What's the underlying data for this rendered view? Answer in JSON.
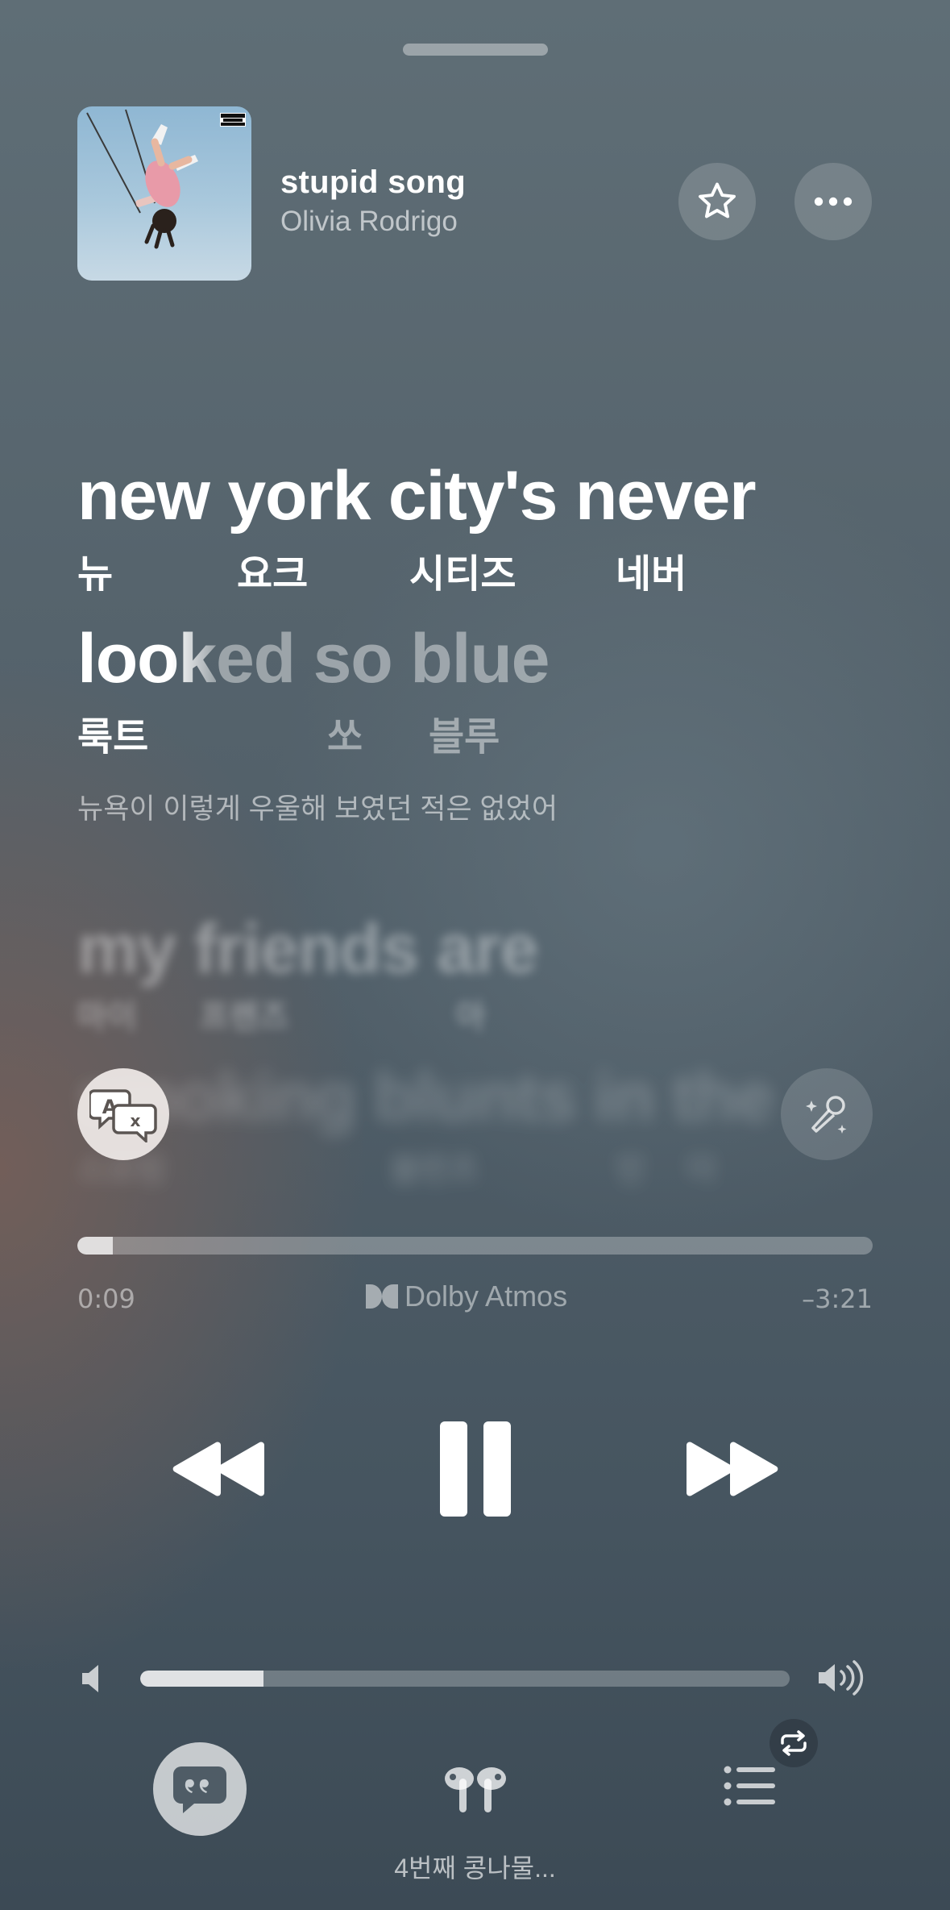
{
  "now_playing": {
    "title": "stupid song",
    "artist": "Olivia Rodrigo",
    "explicit_badge": "PARENTAL ADVISORY"
  },
  "header_buttons": {
    "favorite_icon": "star-icon",
    "more_icon": "ellipsis-icon"
  },
  "lyrics": {
    "current_line": {
      "words": [
        "new",
        "york",
        "city's",
        "never"
      ],
      "romanization": [
        "뉴",
        "요크",
        "시티즈",
        "네버"
      ]
    },
    "active_line": {
      "sung_text": "look",
      "unsung_text": "ed so blue",
      "romanization": [
        "룩트",
        "쏘",
        "블루"
      ],
      "translation": "뉴욕이 이렇게 우울해 보였던 적은 없었어"
    },
    "next_lines": [
      {
        "text": "my friends are",
        "romanization": [
          "마이",
          "프렌즈",
          "아"
        ]
      },
      {
        "text": "smoking blunts in the",
        "romanization": [
          "스모킹",
          "블런츠",
          "인",
          "더"
        ]
      }
    ]
  },
  "lyric_controls": {
    "translate_icon": "translate-icon",
    "sing_icon": "microphone-sparkle-icon"
  },
  "playback": {
    "elapsed": "0:09",
    "remaining": "–3:21",
    "progress": 0.045,
    "audio_format": "Dolby Atmos",
    "state": "playing"
  },
  "volume": {
    "level": 0.19
  },
  "bottom_bar": {
    "lyrics_icon": "quote-bubble-icon",
    "airplay_icon": "airpods-icon",
    "device_name": "4번째 콩나물...",
    "queue_icon": "list-icon",
    "repeat_icon": "repeat-icon"
  },
  "colors": {
    "background_top": "#5f6e76",
    "background_bottom": "#3c4a55",
    "accent": "#ffffff"
  }
}
